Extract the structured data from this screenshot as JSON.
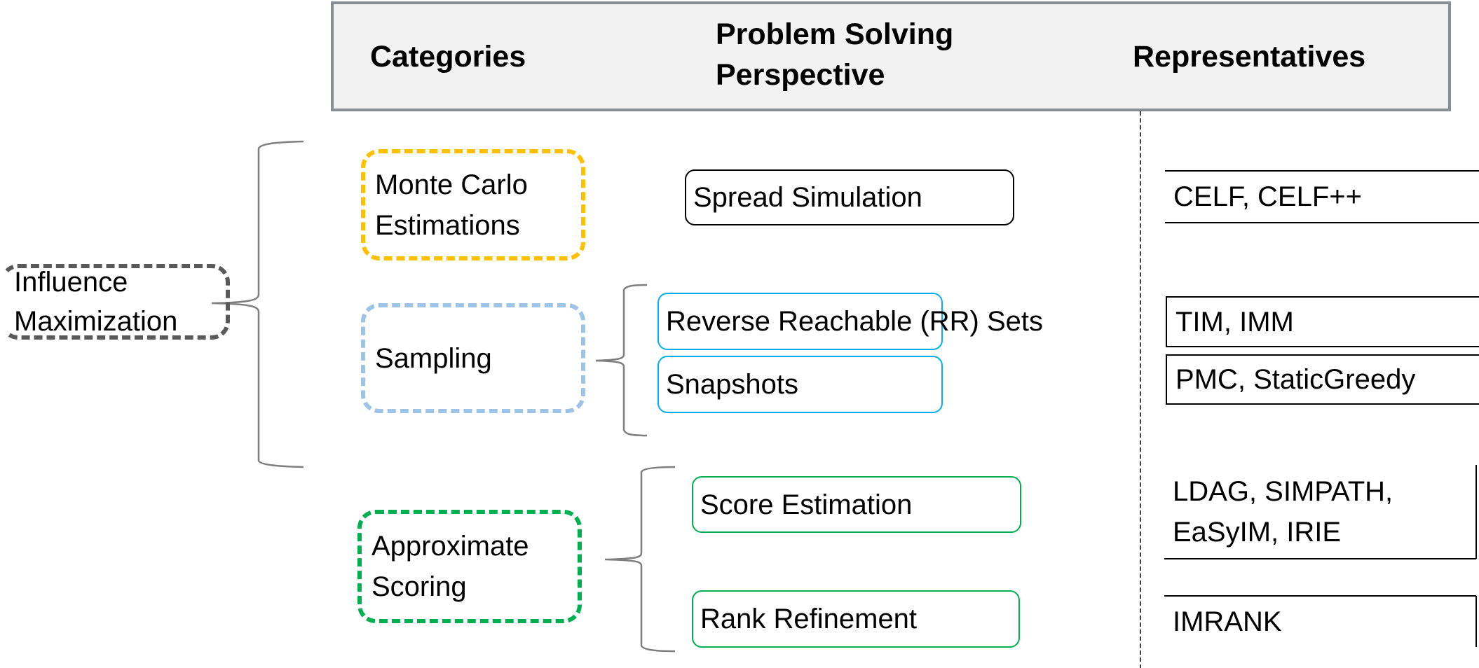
{
  "header": {
    "col_categories": "Categories",
    "col_perspective_line1": "Problem Solving",
    "col_perspective_line2": "Perspective",
    "col_representatives": "Representatives"
  },
  "root": {
    "line1": "Influence",
    "line2": "Maximization",
    "color": "#595959"
  },
  "categories": [
    {
      "line1": "Monte Carlo",
      "line2": "Estimations",
      "color": "#FFC000"
    },
    {
      "line1": "Sampling",
      "line2": "",
      "color": "#9DC3E6"
    },
    {
      "line1": "Approximate",
      "line2": "Scoring",
      "color": "#00B050"
    }
  ],
  "perspectives": [
    {
      "label": "Spread Simulation",
      "color": "#000000"
    },
    {
      "label": "Reverse Reachable (RR) Sets",
      "color": "#00B0F0"
    },
    {
      "label": "Snapshots",
      "color": "#00B0F0"
    },
    {
      "label": "Score Estimation",
      "color": "#00B050"
    },
    {
      "label": "Rank Refinement",
      "color": "#00B050"
    }
  ],
  "representatives": [
    {
      "line1": "CELF, CELF++",
      "line2": ""
    },
    {
      "line1": "TIM, IMM",
      "line2": ""
    },
    {
      "line1": "PMC, StaticGreedy",
      "line2": ""
    },
    {
      "line1": "LDAG, SIMPATH,",
      "line2": "EaSyIM, IRIE"
    },
    {
      "line1": "IMRANK",
      "line2": ""
    }
  ]
}
